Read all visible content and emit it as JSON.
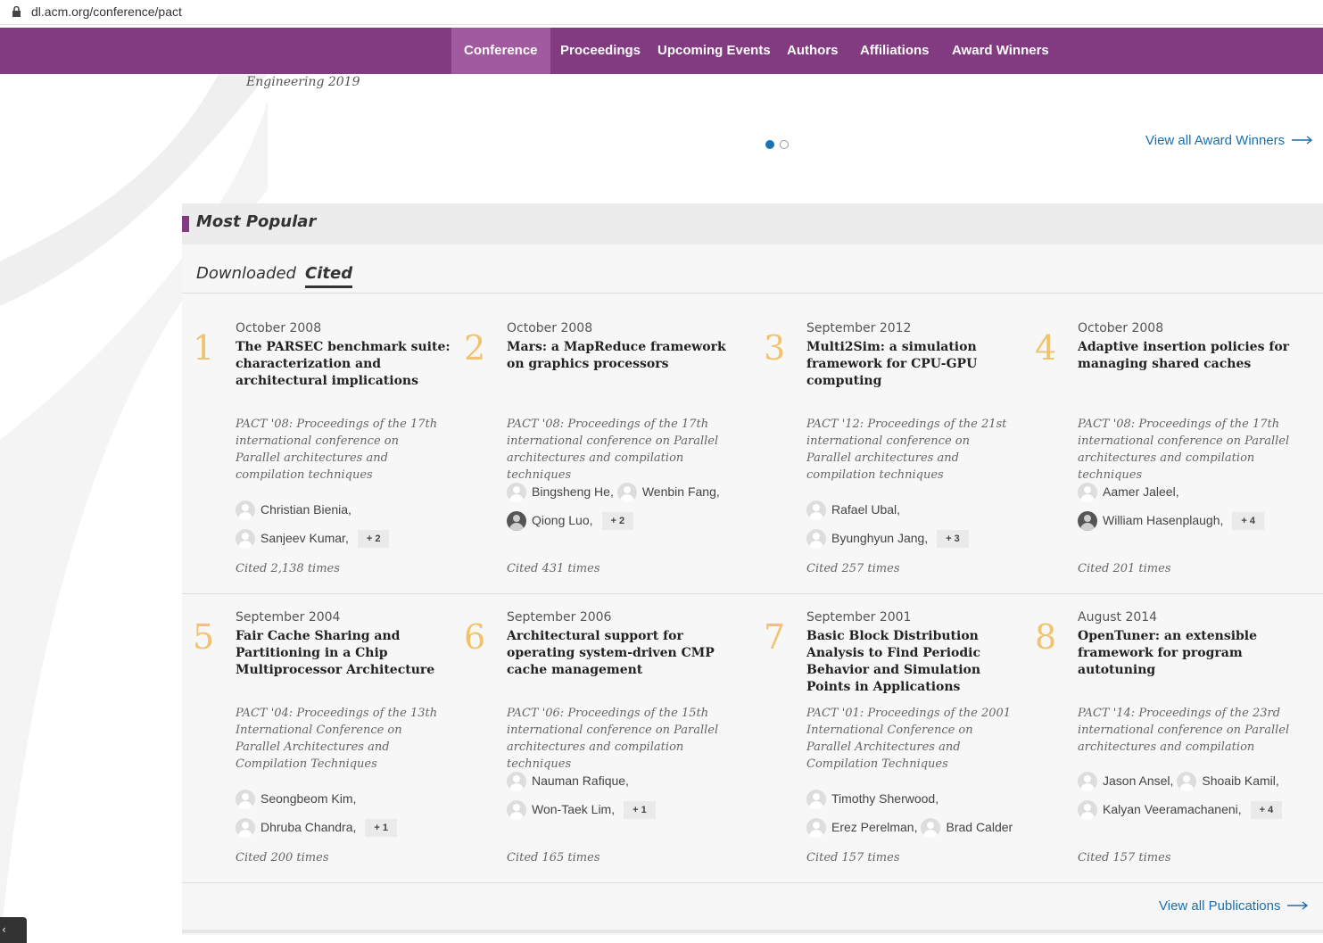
{
  "browser": {
    "url": "dl.acm.org/conference/pact"
  },
  "nav": {
    "items": [
      "Conference",
      "Proceedings",
      "Upcoming Events",
      "Authors",
      "Affiliations",
      "Award Winners"
    ],
    "active": "Conference"
  },
  "carousel": {
    "caption": "Engineering 2019",
    "view_all": "View all Award Winners",
    "slides": 2,
    "current": 1
  },
  "popular": {
    "title": "Most Popular",
    "tabs": [
      "Downloaded",
      "Cited"
    ],
    "active_tab": "Cited",
    "view_all": "View all Publications",
    "items": [
      {
        "num": "1",
        "date": "October 2008",
        "title": "The PARSEC benchmark suite: characterization and architectural implications",
        "proc": "PACT '08: Proceedings of the 17th international conference on Parallel architectures and compilation techniques",
        "author_lines": [
          [
            {
              "name": "Christian Bienia,"
            }
          ],
          [
            {
              "name": "Sanjeev Kumar,"
            }
          ]
        ],
        "more": "+ 2",
        "cited": "Cited 2,138 times"
      },
      {
        "num": "2",
        "date": "October 2008",
        "title": "Mars: a MapReduce framework on graphics processors",
        "proc": "PACT '08: Proceedings of the 17th international conference on Parallel architectures and compilation techniques",
        "author_lines": [
          [
            {
              "name": "Bingsheng He,"
            },
            {
              "name": "Wenbin Fang,"
            }
          ],
          [
            {
              "name": "Qiong Luo,",
              "photo": true
            }
          ]
        ],
        "more": "+ 2",
        "cited": "Cited 431 times"
      },
      {
        "num": "3",
        "date": "September 2012",
        "title": "Multi2Sim: a simulation framework for CPU-GPU computing",
        "proc": "PACT '12: Proceedings of the 21st international conference on Parallel architectures and compilation techniques",
        "author_lines": [
          [
            {
              "name": "Rafael Ubal,"
            }
          ],
          [
            {
              "name": "Byunghyun Jang,"
            }
          ]
        ],
        "more": "+ 3",
        "cited": "Cited 257 times"
      },
      {
        "num": "4",
        "date": "October 2008",
        "title": "Adaptive insertion policies for managing shared caches",
        "proc": "PACT '08: Proceedings of the 17th international conference on Parallel architectures and compilation techniques",
        "author_lines": [
          [
            {
              "name": "Aamer Jaleel,"
            }
          ],
          [
            {
              "name": "William Hasenplaugh,",
              "photo": true
            }
          ]
        ],
        "more": "+ 4",
        "cited": "Cited 201 times"
      },
      {
        "num": "5",
        "date": "September 2004",
        "title": "Fair Cache Sharing and Partitioning in a Chip Multiprocessor Architecture",
        "proc": "PACT '04: Proceedings of the 13th International Conference on Parallel Architectures and Compilation Techniques",
        "author_lines": [
          [
            {
              "name": "Seongbeom Kim,"
            }
          ],
          [
            {
              "name": "Dhruba Chandra,"
            }
          ]
        ],
        "more": "+ 1",
        "cited": "Cited 200 times"
      },
      {
        "num": "6",
        "date": "September 2006",
        "title": "Architectural support for operating system-driven CMP cache management",
        "proc": "PACT '06: Proceedings of the 15th international conference on Parallel architectures and compilation techniques",
        "author_lines": [
          [
            {
              "name": "Nauman Rafique,"
            }
          ],
          [
            {
              "name": "Won-Taek Lim,"
            }
          ]
        ],
        "more": "+ 1",
        "cited": "Cited 165 times"
      },
      {
        "num": "7",
        "date": "September 2001",
        "title": "Basic Block Distribution Analysis to Find Periodic Behavior and Simulation Points in Applications",
        "proc": "PACT '01: Proceedings of the 2001 International Conference on Parallel Architectures and Compilation Techniques",
        "author_lines": [
          [
            {
              "name": "Timothy Sherwood,"
            }
          ],
          [
            {
              "name": "Erez Perelman,"
            },
            {
              "name": "Brad Calder"
            }
          ]
        ],
        "more": "",
        "cited": "Cited 157 times"
      },
      {
        "num": "8",
        "date": "August 2014",
        "title": "OpenTuner: an extensible framework for program autotuning",
        "proc": "PACT '14: Proceedings of the 23rd international conference on Parallel architectures and compilation",
        "author_lines": [
          [
            {
              "name": "Jason Ansel,"
            },
            {
              "name": "Shoaib Kamil,"
            }
          ],
          [
            {
              "name": "Kalyan Veeramachaneni,"
            }
          ]
        ],
        "more": "+ 4",
        "cited": "Cited 157 times"
      }
    ]
  },
  "colors": {
    "brand": "#823a80",
    "link": "#1a6fae",
    "rank_number": "#f0c36c"
  }
}
